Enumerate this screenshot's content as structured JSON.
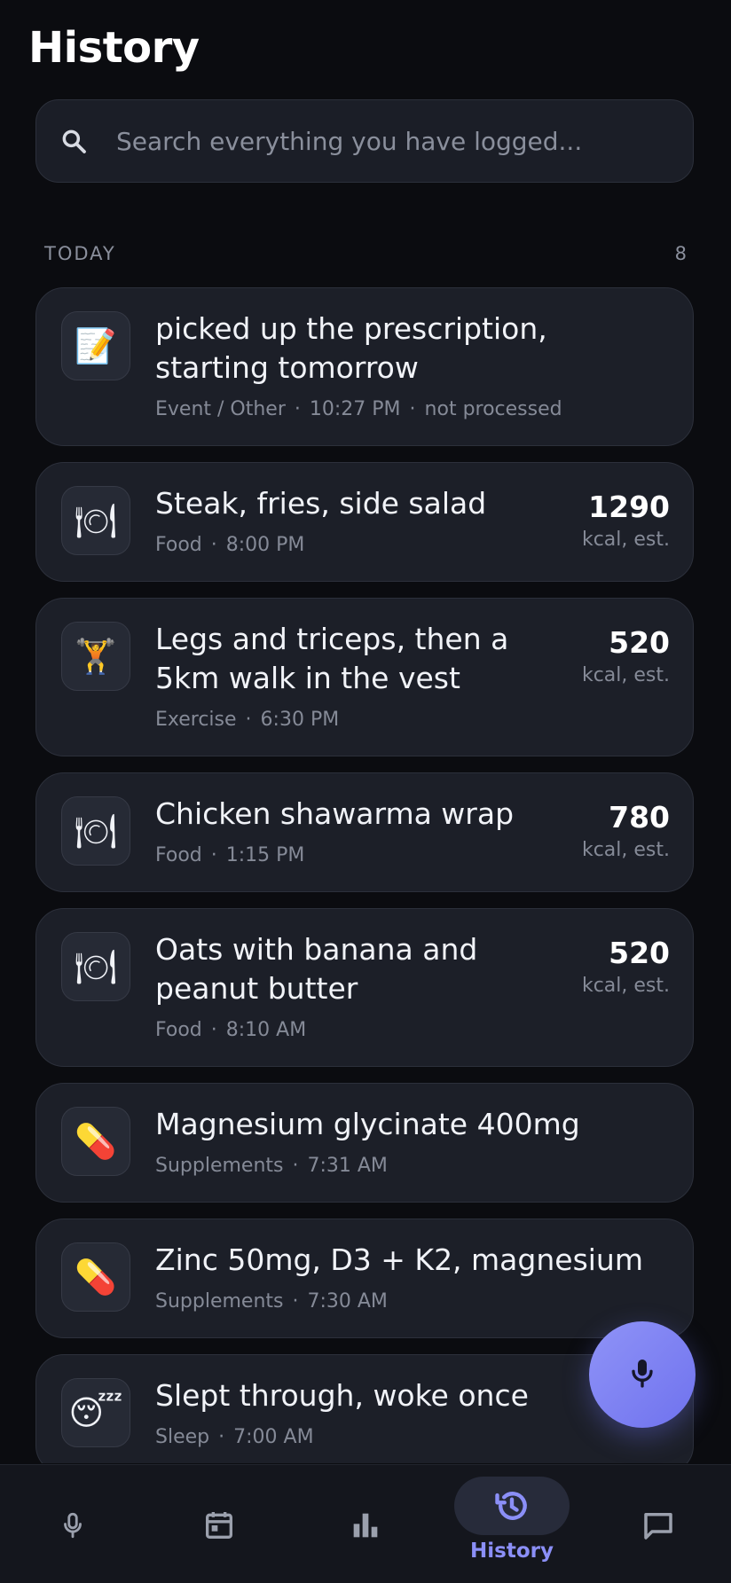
{
  "header": {
    "title": "History"
  },
  "search": {
    "placeholder": "Search everything you have logged..."
  },
  "section": {
    "label": "TODAY",
    "count": "8"
  },
  "entries": [
    {
      "icon": "memo-icon",
      "emoji": "📝",
      "text": "picked up the prescription, starting tomorrow",
      "category": "Event / Other",
      "time": "10:27 PM",
      "status": "not processed"
    },
    {
      "icon": "plate-icon",
      "emoji": "🍽",
      "text": "Steak, fries, side salad",
      "category": "Food",
      "time": "8:00 PM",
      "value": "1290",
      "unit": "kcal, est."
    },
    {
      "icon": "weightlifter-icon",
      "emoji": "🏋",
      "text": "Legs and triceps, then a 5km walk in the vest",
      "category": "Exercise",
      "time": "6:30 PM",
      "value": "520",
      "unit": "kcal, est."
    },
    {
      "icon": "plate-icon",
      "emoji": "🍽",
      "text": "Chicken shawarma wrap",
      "category": "Food",
      "time": "1:15 PM",
      "value": "780",
      "unit": "kcal, est."
    },
    {
      "icon": "plate-icon",
      "emoji": "🍽",
      "text": "Oats with banana and peanut butter",
      "category": "Food",
      "time": "8:10 AM",
      "value": "520",
      "unit": "kcal, est."
    },
    {
      "icon": "pill-icon",
      "emoji": "💊",
      "text": "Magnesium glycinate 400mg",
      "category": "Supplements",
      "time": "7:31 AM"
    },
    {
      "icon": "pill-icon",
      "emoji": "💊",
      "text": "Zinc 50mg, D3 + K2, magnesium",
      "category": "Supplements",
      "time": "7:30 AM"
    },
    {
      "icon": "sleeping-face-icon",
      "emoji": "😴",
      "text": "Slept through, woke once",
      "category": "Sleep",
      "time": "7:00 AM"
    }
  ],
  "nav": {
    "items": [
      {
        "icon": "microphone-icon",
        "label": ""
      },
      {
        "icon": "calendar-icon",
        "label": ""
      },
      {
        "icon": "bar-chart-icon",
        "label": ""
      },
      {
        "icon": "history-icon",
        "label": "History",
        "active": true
      },
      {
        "icon": "chat-icon",
        "label": ""
      }
    ]
  },
  "colors": {
    "accent": "#8b8ff7",
    "background": "#0b0c10",
    "card": "#1c1f28"
  },
  "fab": {
    "icon": "microphone-icon"
  }
}
